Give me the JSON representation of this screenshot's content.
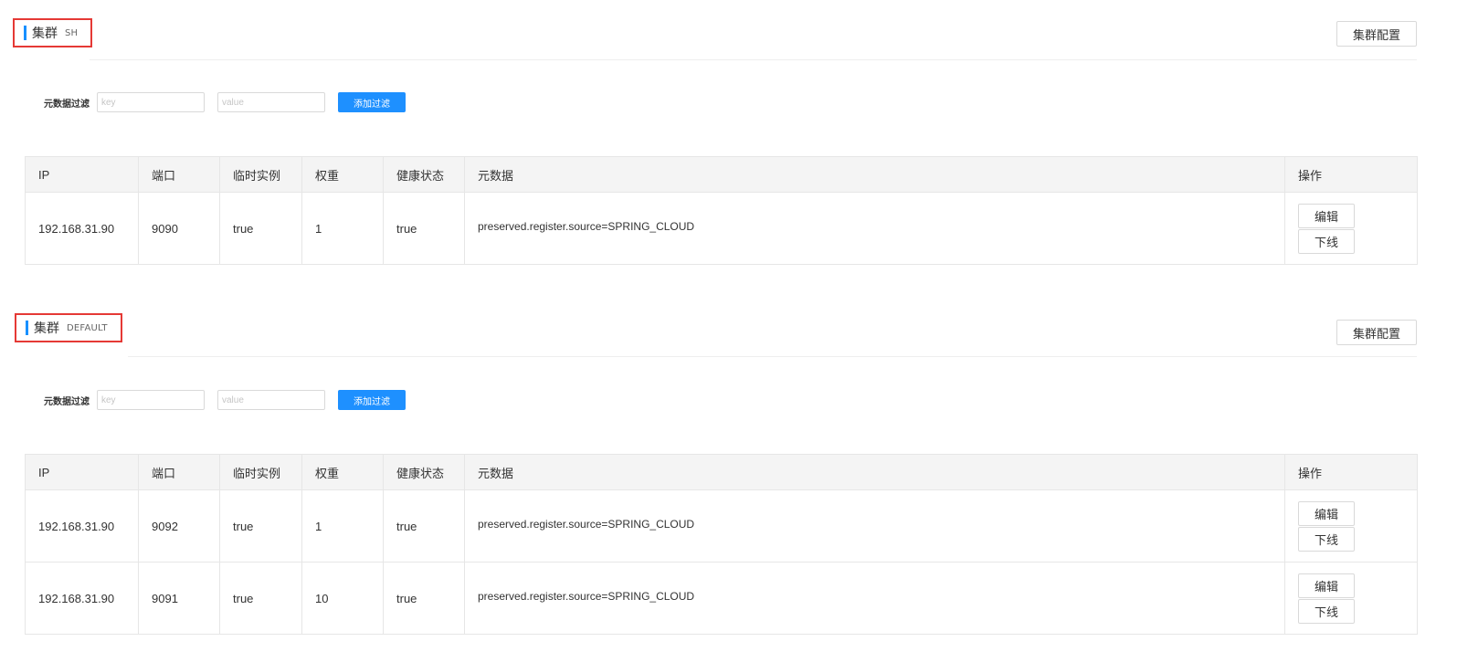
{
  "clusters": [
    {
      "title": "集群",
      "name": "SH",
      "config_label": "集群配置",
      "filter": {
        "label": "元数据过滤",
        "key_placeholder": "key",
        "value_placeholder": "value",
        "add_label": "添加过滤"
      },
      "columns": [
        "IP",
        "端口",
        "临时实例",
        "权重",
        "健康状态",
        "元数据",
        "操作"
      ],
      "rows": [
        {
          "ip": "192.168.31.90",
          "port": "9090",
          "ephemeral": "true",
          "weight": "1",
          "healthy": "true",
          "metadata": "preserved.register.source=SPRING_CLOUD",
          "edit_label": "编辑",
          "offline_label": "下线"
        }
      ]
    },
    {
      "title": "集群",
      "name": "DEFAULT",
      "config_label": "集群配置",
      "filter": {
        "label": "元数据过滤",
        "key_placeholder": "key",
        "value_placeholder": "value",
        "add_label": "添加过滤"
      },
      "columns": [
        "IP",
        "端口",
        "临时实例",
        "权重",
        "健康状态",
        "元数据",
        "操作"
      ],
      "rows": [
        {
          "ip": "192.168.31.90",
          "port": "9092",
          "ephemeral": "true",
          "weight": "1",
          "healthy": "true",
          "metadata": "preserved.register.source=SPRING_CLOUD",
          "edit_label": "编辑",
          "offline_label": "下线"
        },
        {
          "ip": "192.168.31.90",
          "port": "9091",
          "ephemeral": "true",
          "weight": "10",
          "healthy": "true",
          "metadata": "preserved.register.source=SPRING_CLOUD",
          "edit_label": "编辑",
          "offline_label": "下线"
        }
      ]
    }
  ],
  "colors": {
    "accent": "#1890ff",
    "primary_button": "#1e90ff",
    "highlight_border": "#e53935"
  }
}
